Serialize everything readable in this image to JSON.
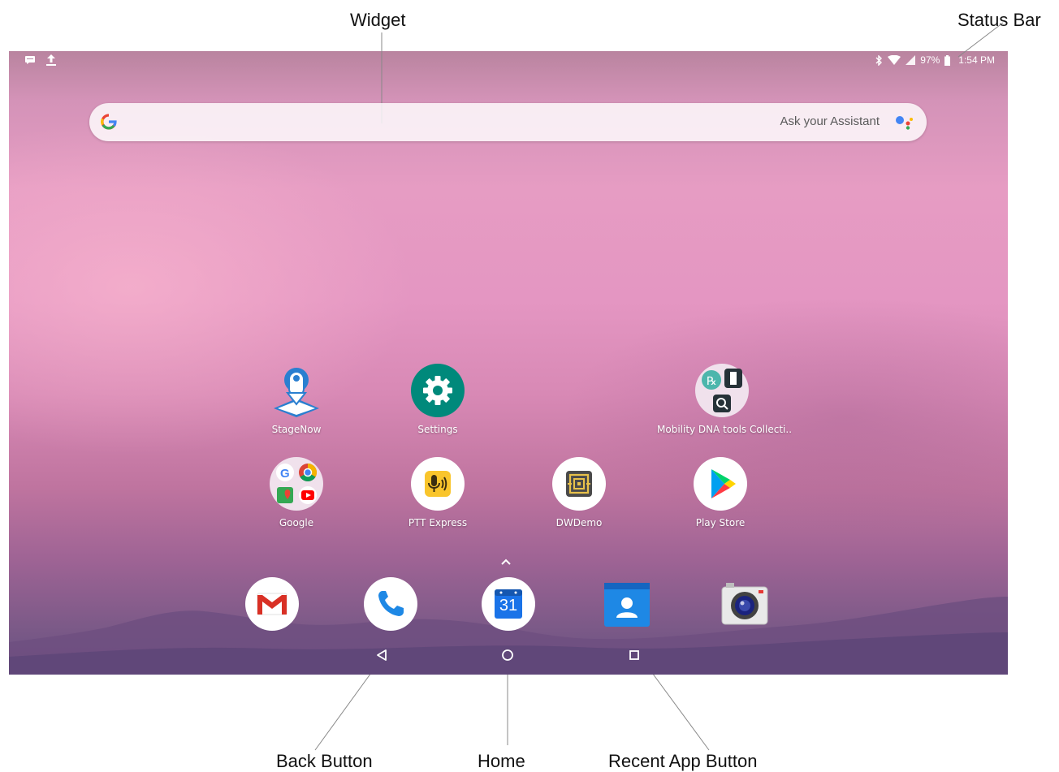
{
  "callouts": {
    "widget": "Widget",
    "status_bar": "Status Bar",
    "back_button": "Back Button",
    "home": "Home",
    "recent_app_button": "Recent App Button"
  },
  "status_bar": {
    "battery": "97%",
    "time": "1:54 PM",
    "left_icons": [
      "message-icon",
      "upload-icon"
    ],
    "right_icons": [
      "bluetooth-icon",
      "wifi-icon",
      "signal-icon",
      "battery-icon"
    ]
  },
  "search_widget": {
    "assistant_label": "Ask your Assistant",
    "icons": [
      "google-g-icon",
      "google-assistant-icon"
    ]
  },
  "home_apps": [
    {
      "label": "StageNow",
      "icon": "stagenow-icon"
    },
    {
      "label": "Settings",
      "icon": "settings-gear-icon"
    },
    {
      "label": "Mobility DNA tools Collecti..",
      "icon": "folder-icon"
    },
    {
      "label": "Google",
      "icon": "folder-icon"
    },
    {
      "label": "PTT Express",
      "icon": "ptt-express-icon"
    },
    {
      "label": "DWDemo",
      "icon": "dwdemo-icon"
    },
    {
      "label": "Play Store",
      "icon": "play-store-icon"
    }
  ],
  "dock": [
    {
      "name": "Gmail",
      "icon": "gmail-icon"
    },
    {
      "name": "Phone",
      "icon": "phone-icon"
    },
    {
      "name": "Calendar",
      "icon": "calendar-icon",
      "text": "31"
    },
    {
      "name": "Contacts",
      "icon": "contacts-icon"
    },
    {
      "name": "Camera",
      "icon": "camera-icon"
    }
  ],
  "navigation": [
    "back-icon",
    "home-icon",
    "recent-apps-icon"
  ],
  "colors": {
    "settings": "#00897b",
    "ptt": "#f9c52c",
    "gmail_red": "#d93025",
    "phone_blue": "#1e88e5",
    "calendar_blue": "#1a73e8",
    "contacts_blue": "#1e88e5"
  }
}
